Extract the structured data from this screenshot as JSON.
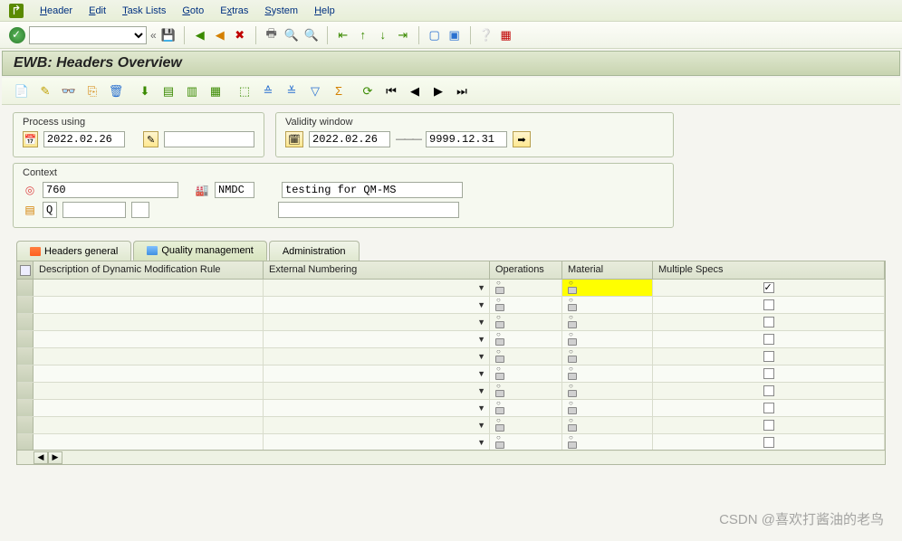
{
  "menu": {
    "header": "Header",
    "edit": "Edit",
    "tasklists": "Task Lists",
    "goto": "Goto",
    "extras": "Extras",
    "system": "System",
    "help": "Help"
  },
  "title": "EWB: Headers Overview",
  "process": {
    "title": "Process using",
    "date": "2022.02.26"
  },
  "validity": {
    "title": "Validity window",
    "from": "2022.02.26",
    "to": "9999.12.31"
  },
  "context": {
    "title": "Context",
    "field1": "760",
    "plant": "NMDC",
    "desc": "testing for QM-MS",
    "q": "Q"
  },
  "tabs": {
    "t1": "Headers general",
    "t2": "Quality management",
    "t3": "Administration"
  },
  "cols": {
    "c1": "Description of Dynamic Modification Rule",
    "c2": "External Numbering",
    "c3": "Operations",
    "c4": "Material",
    "c5": "Multiple Specs"
  },
  "rows": [
    {
      "checked": true,
      "mat_hl": true
    },
    {
      "checked": false
    },
    {
      "checked": false
    },
    {
      "checked": false
    },
    {
      "checked": false
    },
    {
      "checked": false
    },
    {
      "checked": false
    },
    {
      "checked": false
    },
    {
      "checked": false
    },
    {
      "checked": false
    }
  ],
  "watermark": "CSDN @喜欢打酱油的老鸟"
}
